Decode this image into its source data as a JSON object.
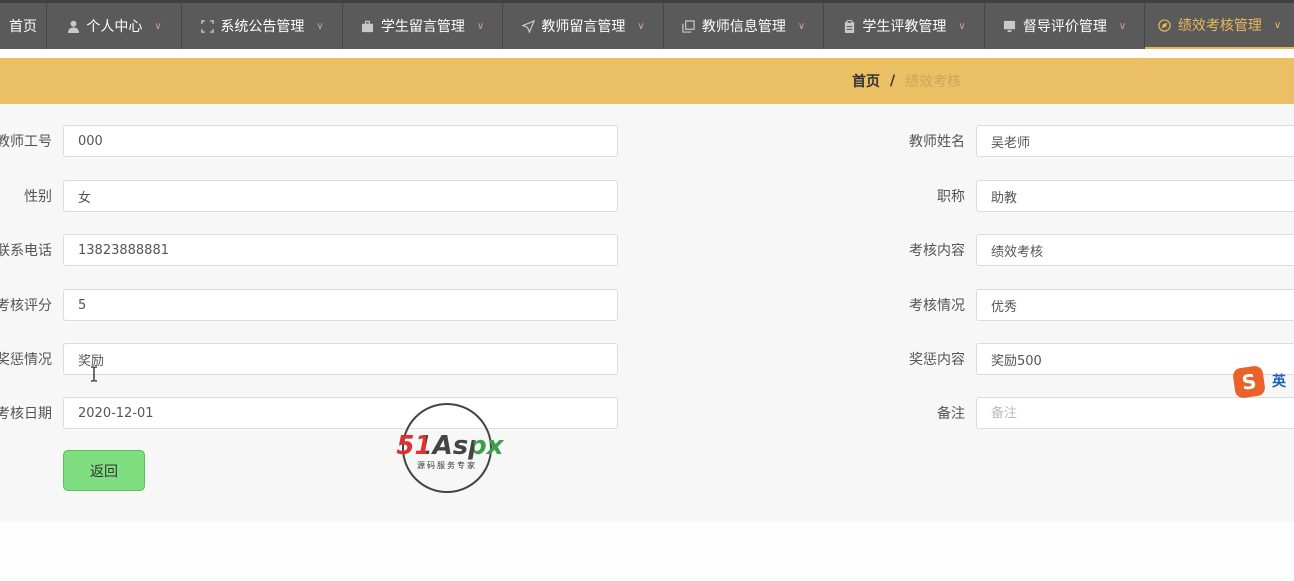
{
  "nav": {
    "items": [
      {
        "label": "首页",
        "icon": "",
        "chevron": false
      },
      {
        "label": "个人中心",
        "icon": "user-icon",
        "chevron": true
      },
      {
        "label": "系统公告管理",
        "icon": "expand-icon",
        "chevron": true
      },
      {
        "label": "学生留言管理",
        "icon": "briefcase-icon",
        "chevron": true
      },
      {
        "label": "教师留言管理",
        "icon": "send-icon",
        "chevron": true
      },
      {
        "label": "教师信息管理",
        "icon": "copy-icon",
        "chevron": true
      },
      {
        "label": "学生评教管理",
        "icon": "clipboard-icon",
        "chevron": true
      },
      {
        "label": "督导评价管理",
        "icon": "monitor-icon",
        "chevron": true
      },
      {
        "label": "绩效考核管理",
        "icon": "compass-icon",
        "chevron": true,
        "active": true
      }
    ]
  },
  "breadcrumb": {
    "home": "首页",
    "separator": "/",
    "current": "绩效考核"
  },
  "form": {
    "teacher_no": {
      "label": "教师工号",
      "value": "000"
    },
    "teacher_name": {
      "label": "教师姓名",
      "value": "吴老师"
    },
    "gender": {
      "label": "性别",
      "value": "女"
    },
    "title": {
      "label": "职称",
      "value": "助教"
    },
    "phone": {
      "label": "联系电话",
      "value": "13823888881"
    },
    "content": {
      "label": "考核内容",
      "value": "绩效考核"
    },
    "score": {
      "label": "考核评分",
      "value": "5"
    },
    "status": {
      "label": "考核情况",
      "value": "优秀"
    },
    "reward": {
      "label": "奖惩情况",
      "value": "奖励"
    },
    "reward_content": {
      "label": "奖惩内容",
      "value": "奖励500"
    },
    "date": {
      "label": "考核日期",
      "value": "2020-12-01"
    },
    "remark": {
      "label": "备注",
      "value": "",
      "placeholder": "备注"
    }
  },
  "back_button": "返回",
  "watermark": {
    "brand": "51Aspx",
    "tagline": "源码服务专家"
  },
  "ime": {
    "logo": "S",
    "mode": "英"
  },
  "colors": {
    "nav_bg": "#5a5a5a",
    "accent": "#e7b85a",
    "band": "#ebc064",
    "button": "#7fde7f"
  }
}
